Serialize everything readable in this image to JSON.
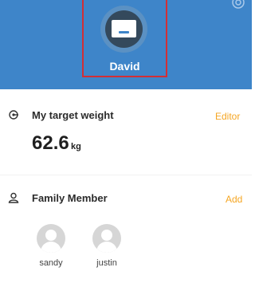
{
  "profile": {
    "name": "David"
  },
  "icons": {
    "settings": "settings-icon",
    "target": "target-icon",
    "family": "person-icon",
    "avatar": "avatar-placeholder-icon"
  },
  "target_weight": {
    "label": "My target weight",
    "edit_label": "Editor",
    "value": "62.6",
    "unit": "kg"
  },
  "family": {
    "label": "Family Member",
    "add_label": "Add",
    "members": [
      {
        "name": "sandy"
      },
      {
        "name": "justin"
      }
    ]
  },
  "colors": {
    "header": "#3e85c9",
    "accent": "#f5a623",
    "highlight_border": "#d22f36"
  }
}
